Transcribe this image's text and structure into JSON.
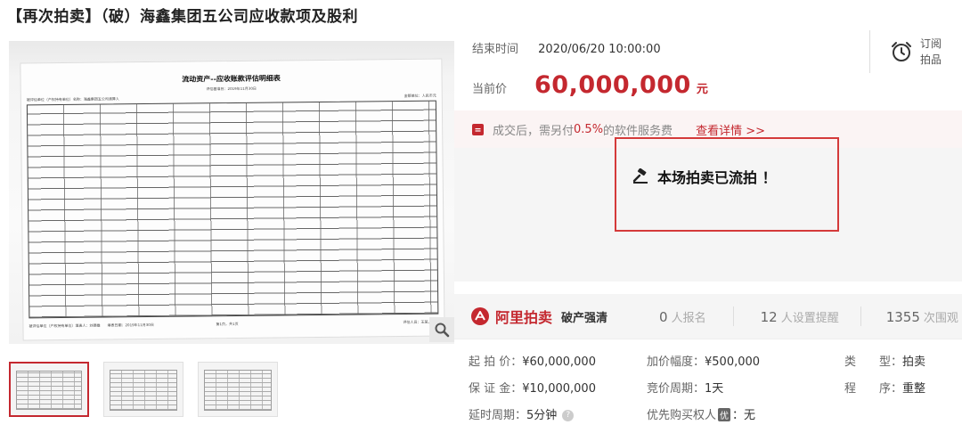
{
  "title": "【再次拍卖】（破）海鑫集团五公司应收款项及股利",
  "document": {
    "title": "流动资产--应收账款评估明细表",
    "subtitle": "评估基准日：2019年11月30日",
    "meta_left": "被评估单位（产权持有单位）名称：海鑫集团五公司清算人",
    "meta_right": "金额单位：人民币元",
    "footer_left": "被评估单位（产权持有单位）填表人：刘德雄　　填表日期：2019年11月30日",
    "footer_mid": "第1页，共1页",
    "footer_right": "评估人员：王某、周某"
  },
  "auction": {
    "end_label": "结束时间",
    "end_value": "2020/06/20 10:00:00",
    "price_label": "当前价",
    "price_value": "60,000,000",
    "price_unit": "元",
    "subscribe_label": "订阅拍品",
    "fee_prefix": "成交后，需另付",
    "fee_rate": "0.5%",
    "fee_suffix": "的软件服务费",
    "fee_link": "查看详情 >>",
    "status_text": "本场拍卖已流拍 ！"
  },
  "stats": {
    "brand_name": "阿里拍卖",
    "brand_tag": "破产强清",
    "signups_num": "0",
    "signups_label": "人报名",
    "reminders_num": "12",
    "reminders_label": "人设置提醒",
    "views_num": "1355",
    "views_label": "次围观"
  },
  "info": {
    "start_price_label": "起 拍 价：",
    "start_price": "¥60,000,000",
    "increment_label": "加价幅度：",
    "increment": "¥500,000",
    "type_label": "类　　型：",
    "type": "拍卖",
    "deposit_label": "保 证 金：",
    "deposit": "¥10,000,000",
    "cycle_label": "竞价周期：",
    "cycle": "1天",
    "procedure_label": "程　　序：",
    "procedure": "重整",
    "delay_label": "延时周期：",
    "delay": "5分钟",
    "priority_label": "优先购买权人",
    "priority_badge": "优",
    "priority_value": "：无"
  },
  "colors": {
    "accent": "#c4282f",
    "status_border": "#d43a3a"
  },
  "icons": [
    "zoom-icon",
    "alarm-clock-icon",
    "fee-tag-icon",
    "gavel-icon",
    "ali-auction-logo-icon",
    "help-icon"
  ]
}
